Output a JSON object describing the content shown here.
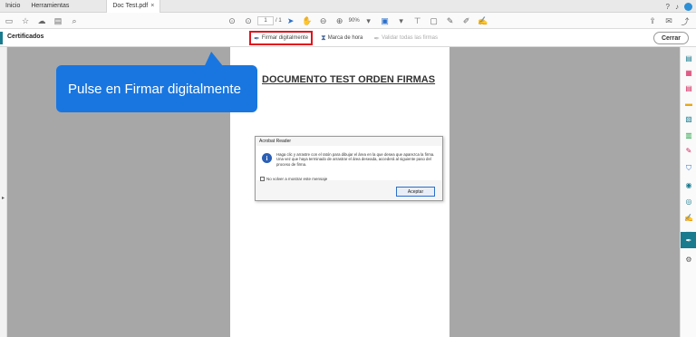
{
  "tabs": {
    "home": "Inicio",
    "tools": "Herramientas",
    "document": "Doc Test.pdf",
    "close_glyph": "×"
  },
  "toolbar": {
    "page_current": "1",
    "page_total": "/ 1",
    "zoom": "90%"
  },
  "certbar": {
    "title": "Certificados",
    "sign_digitally": "Firmar digitalmente",
    "timestamp": "Marca de hora",
    "validate_all": "Validar todas las firmas",
    "close": "Cerrar"
  },
  "document": {
    "title": "DOCUMENTO TEST ORDEN FIRMAS"
  },
  "dialog": {
    "title": "Acrobat Reader",
    "message": "Haga clic y arrastre con el ratón para dibujar el área en la que desea que aparezca la firma. Una vez que haya terminado de arrastrar el área deseada, accederá al siguiente paso del proceso de firma.",
    "checkbox_label": "No volver a mostrar este mensaje",
    "accept": "Aceptar"
  },
  "callout": {
    "text": "Pulse en Firmar digitalmente"
  },
  "colors": {
    "accent": "#1a7a8e",
    "callout": "#1976e0",
    "highlight": "#e0141e"
  }
}
